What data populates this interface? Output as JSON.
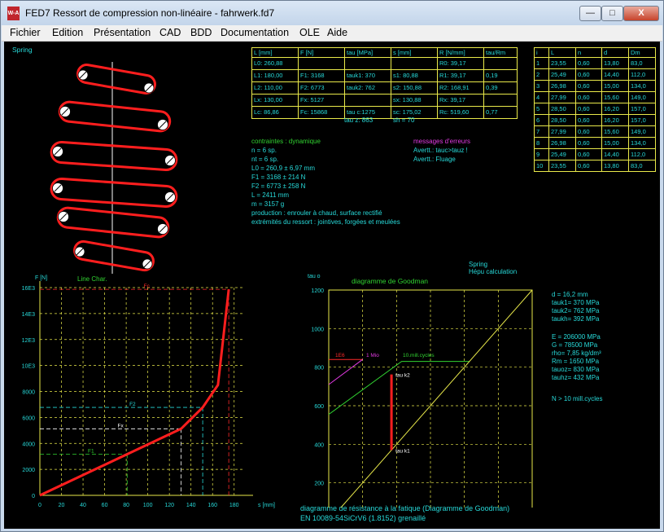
{
  "window": {
    "title": "FED7   Ressort de compression non-linéaire  -  fahrwerk.fd7",
    "app_icon": "W-A",
    "minimize_glyph": "—",
    "maximize_glyph": "□",
    "close_glyph": "X"
  },
  "menu": [
    "Fichier",
    "Edition",
    "Présentation",
    "CAD",
    "BDD",
    "Documentation",
    "OLE",
    "Aide"
  ],
  "spring_view": {
    "label": "Spring"
  },
  "results_table": {
    "headers": [
      "L [mm]",
      "F [N]",
      "tau [MPa]",
      "s [mm]",
      "R [N/mm]",
      "tau/Rm"
    ],
    "rows": [
      [
        "L0: 260,88",
        "",
        "",
        "",
        "R0: 39,17",
        ""
      ],
      [
        "L1: 180,00",
        "F1: 3168",
        "tauk1: 370",
        "s1: 80,88",
        "R1:  39,17",
        "0,19"
      ],
      [
        "L2: 110,00",
        "F2: 6773",
        "tauk2: 762",
        "s2: 150,88",
        "R2: 168,91",
        "0,39"
      ],
      [
        "Lx: 130,00",
        "Fx: 5127",
        "",
        "sx: 130,88",
        "Rx:  39,17",
        ""
      ],
      [
        "Lc:  86,86",
        "Fc: 15868",
        "tau c:1275",
        "sc: 175,02",
        "Rc: 519,60",
        "0,77"
      ]
    ],
    "footer": [
      "tau z: 863",
      "sh = 70"
    ]
  },
  "coils_table": {
    "headers": [
      "i",
      "L",
      "n",
      "d",
      "Dm"
    ],
    "rows": [
      [
        "1",
        "23,55",
        "0,60",
        "13,80",
        "83,0"
      ],
      [
        "2",
        "25,49",
        "0,60",
        "14,40",
        "112,0"
      ],
      [
        "3",
        "26,98",
        "0,60",
        "15,00",
        "134,0"
      ],
      [
        "4",
        "27,99",
        "0,60",
        "15,60",
        "149,0"
      ],
      [
        "5",
        "28,50",
        "0,60",
        "16,20",
        "157,0"
      ],
      [
        "6",
        "28,50",
        "0,60",
        "16,20",
        "157,0"
      ],
      [
        "7",
        "27,99",
        "0,60",
        "15,60",
        "149,0"
      ],
      [
        "8",
        "26,98",
        "0,60",
        "15,00",
        "134,0"
      ],
      [
        "9",
        "25,49",
        "0,60",
        "14,40",
        "112,0"
      ],
      [
        "10",
        "23,55",
        "0,60",
        "13,80",
        "83,0"
      ]
    ]
  },
  "info": {
    "lines": [
      "contraintes : dynamique",
      "n    = 6 sp.",
      "nt = 6 sp.",
      "L0 = 260,9 ± 6,97 mm",
      "F1 = 3168 ± 214 N",
      "F2 = 6773 ± 258 N",
      "L = 2411 mm",
      "m = 3157 g",
      "production : enrouler à chaud, surface rectifié",
      "extrémités du ressort : jointives, forgées et meulées"
    ],
    "errors_title": "messages d'erreurs",
    "errors": [
      "Avertt.: tauc>tauz !",
      "Avertt.: Fluage"
    ]
  },
  "goodman_info": {
    "header": [
      "Spring",
      "Hépu calculation"
    ],
    "lines": [
      "d  = 16,2 mm",
      "tauk1=  370 MPa",
      "tauk2=  762 MPa",
      "taukh=  392 MPa",
      "",
      "E = 206000 MPa",
      "G =  78500 MPa",
      "rho=  7,85 kg/dm³",
      "Rm =  1650 MPa",
      "tauoz=  830 MPa",
      "tauhz=  432 MPa",
      "",
      "N > 10 mill.cycles"
    ],
    "footer": [
      "diagramme de résistance à la fatique (Diagramme de Goodman)",
      "EN 10089-54SiCrV6 (1.8152) grenaillé"
    ]
  },
  "chart_data": [
    {
      "type": "line",
      "title": "Line Char.",
      "xlabel": "s [mm]",
      "ylabel": "F [N]",
      "xlim": [
        0,
        190
      ],
      "ylim": [
        0,
        16000
      ],
      "x_ticks": [
        0,
        20,
        40,
        60,
        80,
        100,
        120,
        140,
        160,
        180
      ],
      "y_ticks": [
        0,
        2000,
        4000,
        6000,
        8000,
        10000,
        12000,
        14000,
        16000
      ],
      "y_tick_labels": [
        "0",
        "2000",
        "4000",
        "6000",
        "8000",
        "10E3",
        "12E3",
        "14E3",
        "16E3"
      ],
      "series": [
        {
          "values_x": [
            0,
            130.88,
            150.88,
            165,
            175.02
          ],
          "values_y": [
            0,
            5127,
            6773,
            8500,
            15868
          ],
          "color": "#ff1e1e"
        }
      ],
      "ref_lines": [
        {
          "label": "Fc",
          "y": 15868,
          "x": 175.02
        },
        {
          "label": "F2",
          "y": 6773,
          "x": 150.88
        },
        {
          "label": "Fx",
          "y": 5127,
          "x": 130.88
        },
        {
          "label": "F1",
          "y": 3168,
          "x": 80.88
        }
      ],
      "grid": true
    },
    {
      "type": "line",
      "title": "diagramme de Goodman",
      "xlabel": "tau u",
      "ylabel": "tau o",
      "xlim": [
        0,
        1200
      ],
      "ylim": [
        0,
        1200
      ],
      "x_ticks": [
        0,
        200,
        400,
        600,
        800,
        1000,
        1200
      ],
      "y_ticks": [
        200,
        400,
        600,
        800,
        1000,
        1200
      ],
      "series": [
        {
          "name": "1E6",
          "values_x": [
            0,
            200
          ],
          "values_y": [
            840,
            840
          ],
          "color": "#ff2a2a"
        },
        {
          "name": "1 Mio",
          "values_x": [
            0,
            200
          ],
          "values_y": [
            710,
            840
          ],
          "color": "#e23ae2"
        },
        {
          "name": "10.mill.cycles",
          "values_x": [
            0,
            430,
            830
          ],
          "values_y": [
            555,
            830,
            830
          ],
          "color": "#31d331"
        },
        {
          "name": "",
          "values_x": [
            0,
            1200
          ],
          "values_y": [
            0,
            1200
          ],
          "color": "#e9e94a"
        }
      ],
      "load_line": {
        "x": [
          370,
          370
        ],
        "y": [
          370,
          762
        ],
        "color": "#ff1e1e"
      },
      "markers": [
        {
          "label": "tau k1",
          "x": 370,
          "y": 370
        },
        {
          "label": "tau k2",
          "x": 370,
          "y": 762
        }
      ],
      "grid": true
    }
  ]
}
